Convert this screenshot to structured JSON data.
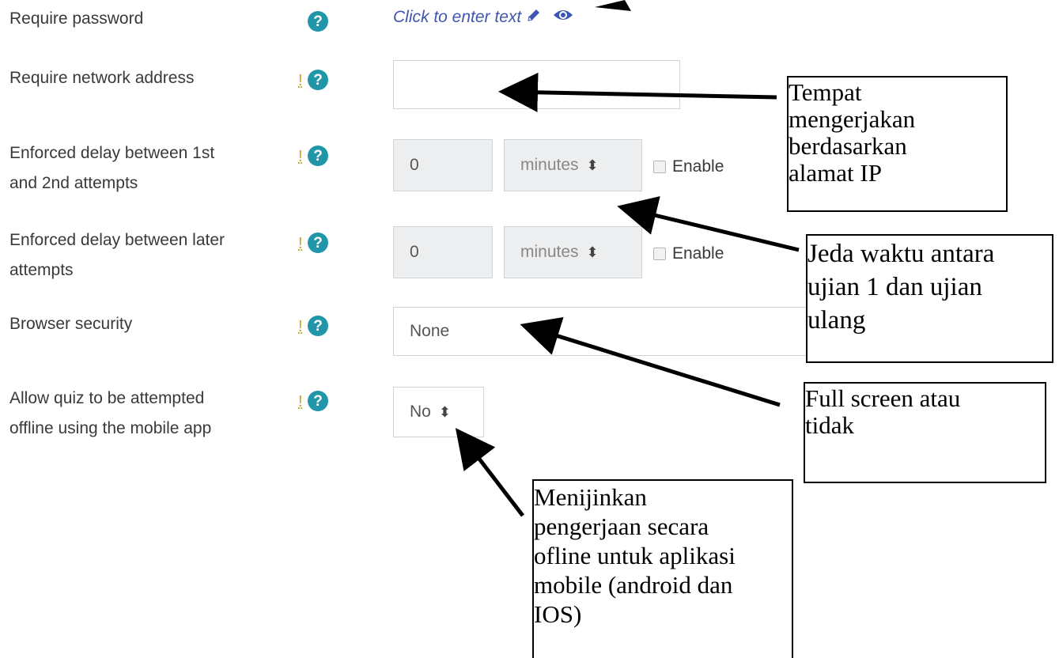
{
  "fields": [
    {
      "label": "Require password",
      "help_icon": "question-circle-icon",
      "value": "Click to enter text"
    },
    {
      "label": "Require network address",
      "advanced_marker": "!",
      "help_icon": "question-circle-icon",
      "value": ""
    },
    {
      "label_line1": "Enforced delay between 1st",
      "label_line2": "and 2nd attempts",
      "advanced_marker": "!",
      "help_icon": "question-circle-icon",
      "value": "0",
      "unit": "minutes",
      "enable_label": "Enable"
    },
    {
      "label_line1": "Enforced delay between later",
      "label_line2": "attempts",
      "advanced_marker": "!",
      "help_icon": "question-circle-icon",
      "value": "0",
      "unit": "minutes",
      "enable_label": "Enable"
    },
    {
      "label": "Browser security",
      "advanced_marker": "!",
      "help_icon": "question-circle-icon",
      "value": "None"
    },
    {
      "label_line1": "Allow quiz to be attempted",
      "label_line2": "offline using the mobile app",
      "advanced_marker": "!",
      "help_icon": "question-circle-icon",
      "value": "No"
    }
  ],
  "icons": {
    "edit": "pencil-icon",
    "reveal": "eye-icon",
    "select_arrow": "sort-arrows-icon"
  },
  "colors": {
    "help_icon": "#2196a8",
    "advanced_marker": "#d4a017",
    "link": "#3d56b2",
    "readonly_bg": "#eceeef"
  },
  "annotations": {
    "network": [
      "Tempat",
      "mengerjakan",
      "berdasarkan",
      "alamat IP"
    ],
    "delay": [
      "Jeda waktu antara",
      "ujian 1 dan ujian",
      "ulang"
    ],
    "browser": [
      "Full screen atau",
      "tidak"
    ],
    "offline": [
      "Menijinkan",
      "pengerjaan secara",
      "ofline untuk aplikasi",
      "mobile (android dan",
      "IOS)"
    ]
  }
}
